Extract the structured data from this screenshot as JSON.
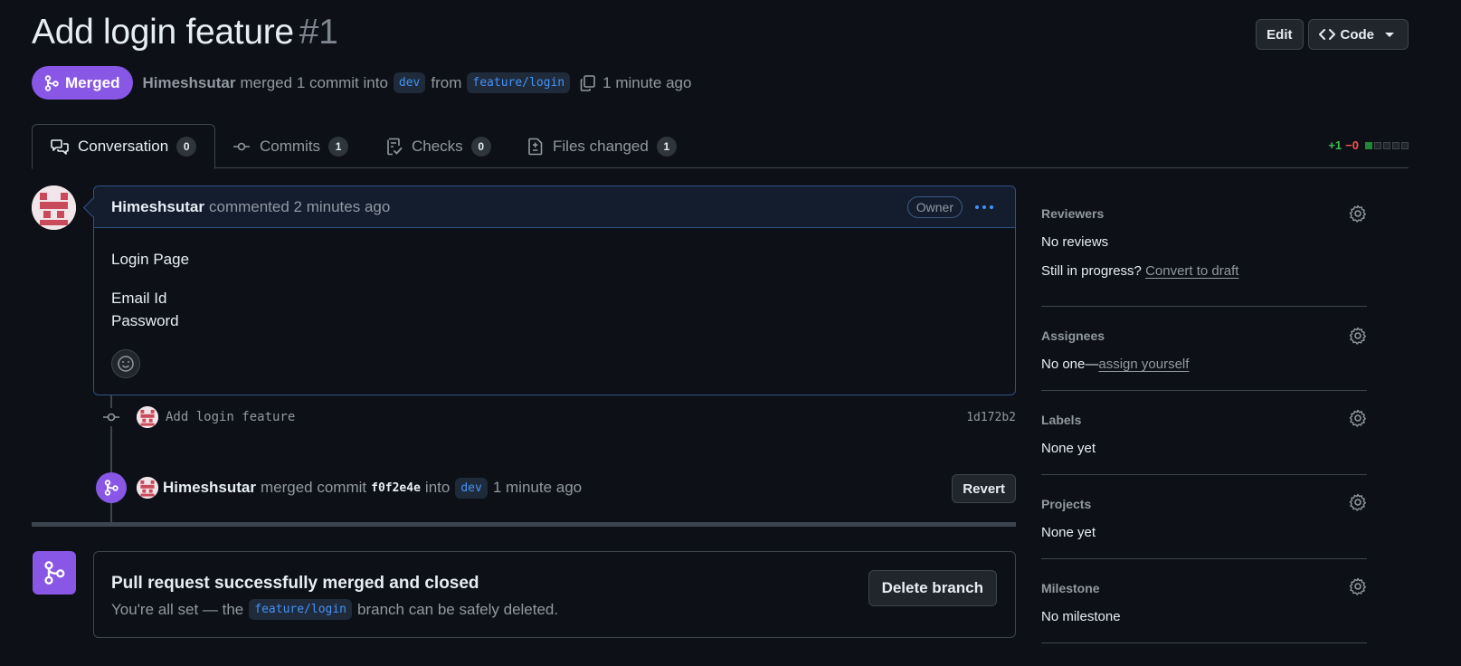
{
  "header": {
    "title": "Add login feature",
    "number": "#1",
    "edit_label": "Edit",
    "code_label": "Code",
    "status": "Merged",
    "author": "Himeshsutar",
    "merge_text": "merged 1 commit into",
    "base_branch": "dev",
    "from_text": "from",
    "head_branch": "feature/login",
    "time": "1 minute ago"
  },
  "tabs": [
    {
      "label": "Conversation",
      "count": "0"
    },
    {
      "label": "Commits",
      "count": "1"
    },
    {
      "label": "Checks",
      "count": "0"
    },
    {
      "label": "Files changed",
      "count": "1"
    }
  ],
  "diffstat": {
    "additions": "+1",
    "deletions": "−0"
  },
  "comment": {
    "author": "Himeshsutar",
    "action": "commented 2 minutes ago",
    "badge": "Owner",
    "body_line1": "Login Page",
    "body_line2": "Email Id",
    "body_line3": "Password"
  },
  "commit": {
    "message": "Add login feature",
    "sha": "1d172b2"
  },
  "merge_event": {
    "author": "Himeshsutar",
    "text": "merged commit",
    "sha": "f0f2e4e",
    "into": "into",
    "branch": "dev",
    "time": "1 minute ago",
    "revert_label": "Revert"
  },
  "merged_box": {
    "title": "Pull request successfully merged and closed",
    "sub_prefix": "You're all set — the",
    "branch": "feature/login",
    "sub_suffix": "branch can be safely deleted.",
    "delete_label": "Delete branch"
  },
  "sidebar": {
    "reviewers": {
      "title": "Reviewers",
      "value": "No reviews",
      "progress_text": "Still in progress?",
      "draft_link": "Convert to draft"
    },
    "assignees": {
      "title": "Assignees",
      "value": "No one—",
      "link": "assign yourself"
    },
    "labels": {
      "title": "Labels",
      "value": "None yet"
    },
    "projects": {
      "title": "Projects",
      "value": "None yet"
    },
    "milestone": {
      "title": "Milestone",
      "value": "No milestone"
    }
  },
  "colors": {
    "accent_merged": "#8957e5",
    "link": "#4493f8",
    "bg": "#0d1117"
  }
}
